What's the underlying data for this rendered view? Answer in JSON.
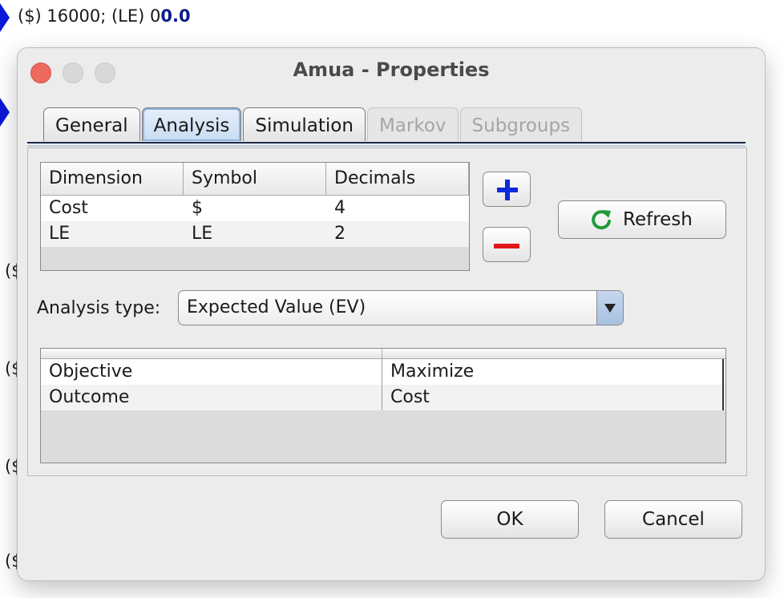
{
  "background": {
    "top_text_prefix": "($) 16000; (LE) 0",
    "top_text_bold": "0.0",
    "partial_texts": [
      "($",
      "($",
      "($",
      "($"
    ]
  },
  "window": {
    "title": "Amua - Properties",
    "tabs": [
      {
        "label": "General",
        "state": "normal"
      },
      {
        "label": "Analysis",
        "state": "active"
      },
      {
        "label": "Simulation",
        "state": "normal"
      },
      {
        "label": "Markov",
        "state": "disabled"
      },
      {
        "label": "Subgroups",
        "state": "disabled"
      }
    ],
    "dimensions_table": {
      "headers": [
        "Dimension",
        "Symbol",
        "Decimals"
      ],
      "rows": [
        [
          "Cost",
          "$",
          "4"
        ],
        [
          "LE",
          "LE",
          "2"
        ]
      ]
    },
    "add_icon": "plus-icon",
    "remove_icon": "minus-icon",
    "refresh_label": "Refresh",
    "refresh_icon": "refresh-icon",
    "analysis_type_label": "Analysis type:",
    "analysis_type_value": "Expected Value (EV)",
    "params_table": {
      "rows": [
        [
          "Objective",
          "Maximize"
        ],
        [
          "Outcome",
          "Cost"
        ]
      ]
    },
    "ok_label": "OK",
    "cancel_label": "Cancel"
  },
  "colors": {
    "accent_blue": "#0b2adb",
    "remove_red": "#e01818",
    "refresh_green": "#1f9a3a",
    "close_red": "#ed6a5e",
    "marker_blue": "#0a18d8"
  }
}
